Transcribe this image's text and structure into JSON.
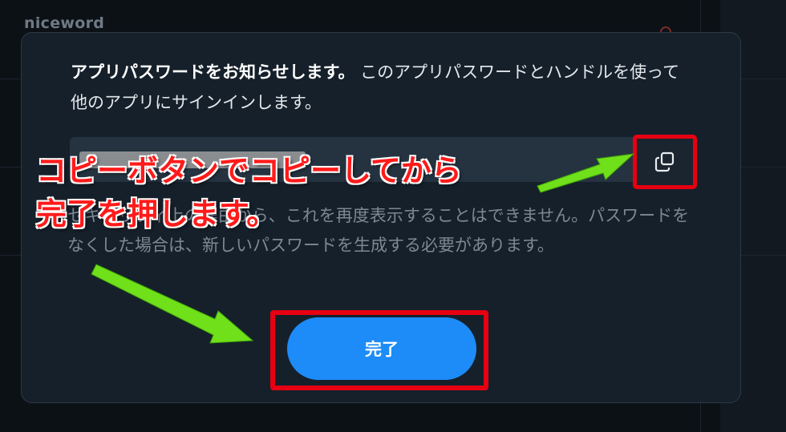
{
  "background": {
    "brand": "niceword"
  },
  "dialog": {
    "message_strong": "アプリパスワードをお知らせします。",
    "message_rest": " このアプリパスワードとハンドルを使って他のアプリにサインインします。",
    "password_masked": true,
    "copy_icon": "copy-icon",
    "warning": "セキュリティ上の理由から、これを再度表示することはできません。パスワードをなくした場合は、新しいパスワードを生成する必要があります。",
    "done_label": "完了"
  },
  "annotation": {
    "text": "コピーボタンでコピーしてから\n完了を押します。",
    "color": "#ff1a1a",
    "highlight_color": "#e60012",
    "arrow_color": "#6fe01a"
  }
}
